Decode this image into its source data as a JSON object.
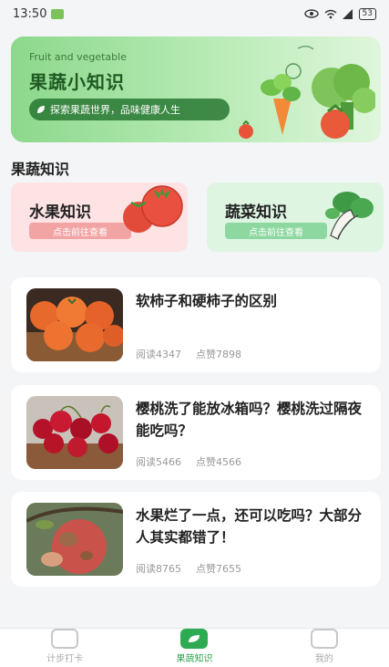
{
  "status_bar": {
    "time": "13:50",
    "battery": "53"
  },
  "banner": {
    "en_title": "Fruit and vegetable",
    "title": "果蔬小知识",
    "subtitle": "探索果蔬世界，品味健康人生"
  },
  "section": {
    "title": "果蔬知识"
  },
  "categories": [
    {
      "name": "水果知识",
      "button": "点击前往查看"
    },
    {
      "name": "蔬菜知识",
      "button": "点击前往查看"
    }
  ],
  "articles": [
    {
      "title": "软柿子和硬柿子的区别",
      "reads": "阅读4347",
      "likes": "点赞7898"
    },
    {
      "title": "樱桃洗了能放冰箱吗？樱桃洗过隔夜能吃吗？",
      "reads": "阅读5466",
      "likes": "点赞4566"
    },
    {
      "title": "水果烂了一点，还可以吃吗？大部分人其实都错了！",
      "reads": "阅读8765",
      "likes": "点赞7655"
    }
  ],
  "tabbar": [
    {
      "label": "计步打卡",
      "icon": "calendar-icon"
    },
    {
      "label": "果蔬知识",
      "icon": "leaf-icon"
    },
    {
      "label": "我的",
      "icon": "profile-icon"
    }
  ],
  "colors": {
    "accent": "#2dab53",
    "fruit_card": "#fde3e3",
    "veg_card": "#def5e2"
  }
}
